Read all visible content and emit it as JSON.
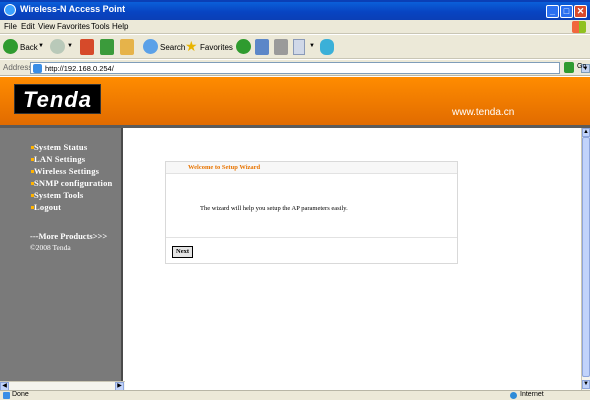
{
  "window": {
    "title": "Wireless-N Access Point"
  },
  "menu": [
    "File",
    "Edit",
    "View",
    "Favorites",
    "Tools",
    "Help"
  ],
  "toolbar": {
    "back_label": "Back",
    "search_label": "Search",
    "favorites_label": "Favorites"
  },
  "address": {
    "label": "Address",
    "url": "http://192.168.0.254/",
    "go_label": "Go"
  },
  "header": {
    "logo_text": "Tenda",
    "site_url": "www.tenda.cn"
  },
  "sidebar": {
    "items": [
      {
        "label": "System Status"
      },
      {
        "label": "LAN Settings"
      },
      {
        "label": "Wireless Settings"
      },
      {
        "label": "SNMP configuration"
      },
      {
        "label": "System Tools"
      },
      {
        "label": "Logout"
      }
    ],
    "more_products": "---More Products>>>",
    "copyright": "©2008 Tenda"
  },
  "wizard": {
    "title": "Welcome to Setup Wizard",
    "body": "The wizard will help you setup the AP parameters easily.",
    "next_label": "Next"
  },
  "status": {
    "text": "Done",
    "zone": "Internet"
  },
  "colors": {
    "header_orange": "#ff8c00",
    "sidebar_gray": "#7a7a7a",
    "wizard_title": "#e87400"
  }
}
